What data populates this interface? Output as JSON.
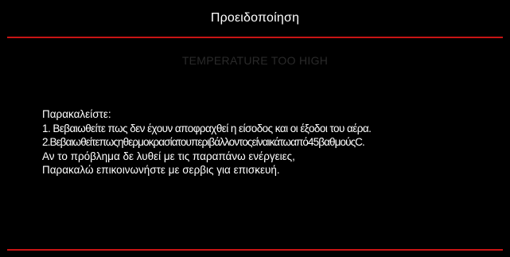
{
  "window": {
    "title": "Προειδοποίηση"
  },
  "warning": {
    "heading": "TEMPERATURE TOO HIGH"
  },
  "message": {
    "lines": [
      "Παρακαλείστε:",
      "1. Βεβαιωθείτε πως δεν έχουν αποφραχθεί η είσοδος και οι έξοδοι του αέρα.",
      "2.Βεβαιωθείτεπωςηθερμοκρασίατουπεριβάλλοντοςείναικάτωαπό45βαθμούςC.",
      "Αν το πρόβλημα δε λυθεί με τις παραπάνω ενέργειες,",
      "Παρακαλώ επικοινωνήστε με σερβις για επισκευή."
    ]
  },
  "colors": {
    "background": "#000000",
    "divider": "#c81414",
    "text": "#ffffff",
    "dimmed_heading": "#2a2a2a"
  }
}
